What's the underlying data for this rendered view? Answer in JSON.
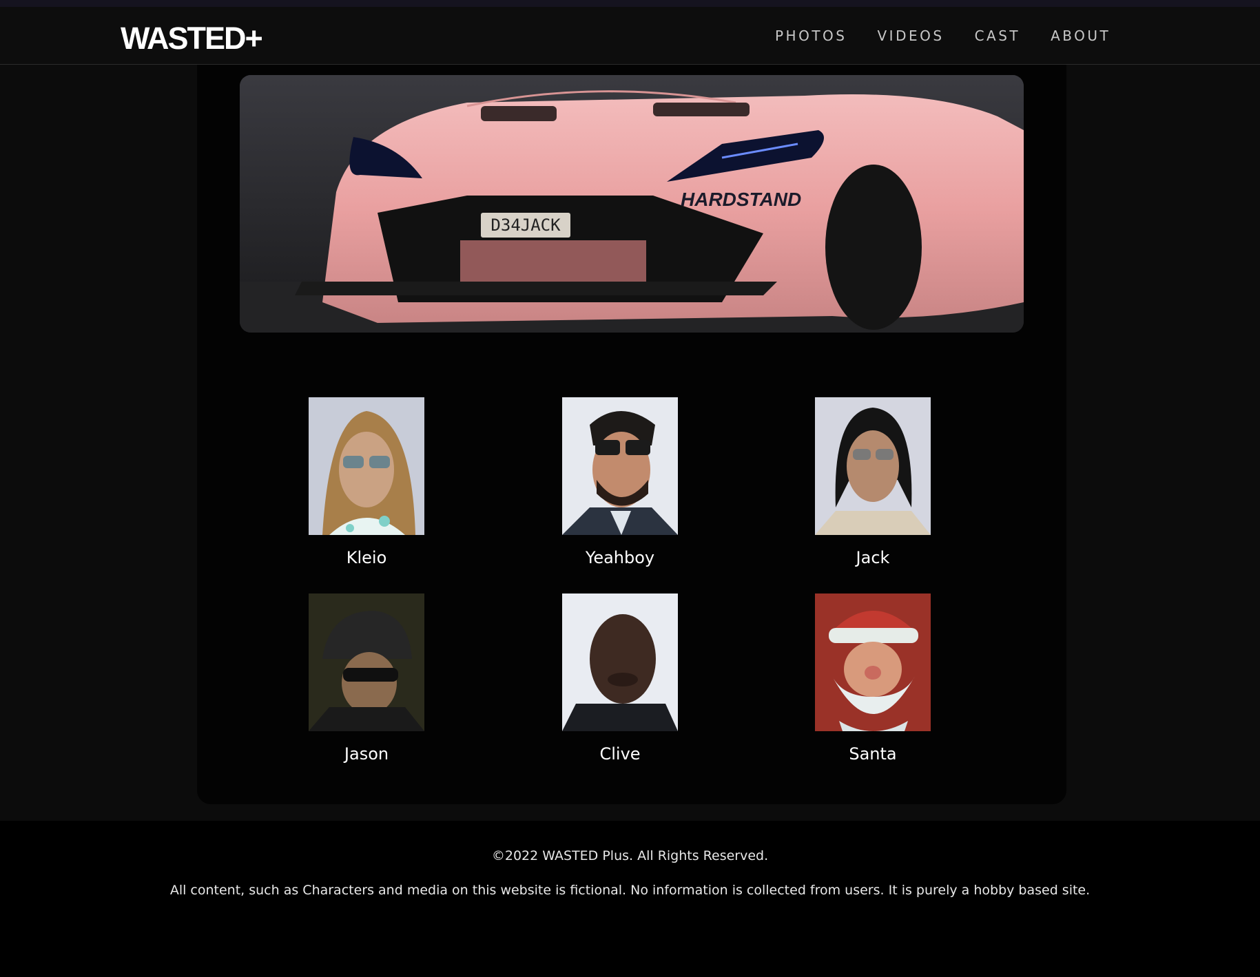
{
  "header": {
    "logo": "WASTED+",
    "nav": [
      {
        "label": "PHOTOS"
      },
      {
        "label": "VIDEOS"
      },
      {
        "label": "CAST"
      },
      {
        "label": "ABOUT"
      }
    ]
  },
  "hero": {
    "plate_text": "D34JACK",
    "decal_text": "HARDSTAND"
  },
  "cast": [
    {
      "name": "Kleio"
    },
    {
      "name": "Yeahboy"
    },
    {
      "name": "Jack"
    },
    {
      "name": "Jason"
    },
    {
      "name": "Clive"
    },
    {
      "name": "Santa"
    }
  ],
  "footer": {
    "copyright": "©2022 WASTED Plus. All Rights Reserved.",
    "disclaimer": "All content, such as Characters and media on this website is fictional. No information is collected from users. It is purely a hobby based site."
  },
  "colors": {
    "background": "#0c0c0c",
    "card": "#030303",
    "nav_text": "#c8c8c8",
    "car_pink": "#e9a3a3"
  }
}
